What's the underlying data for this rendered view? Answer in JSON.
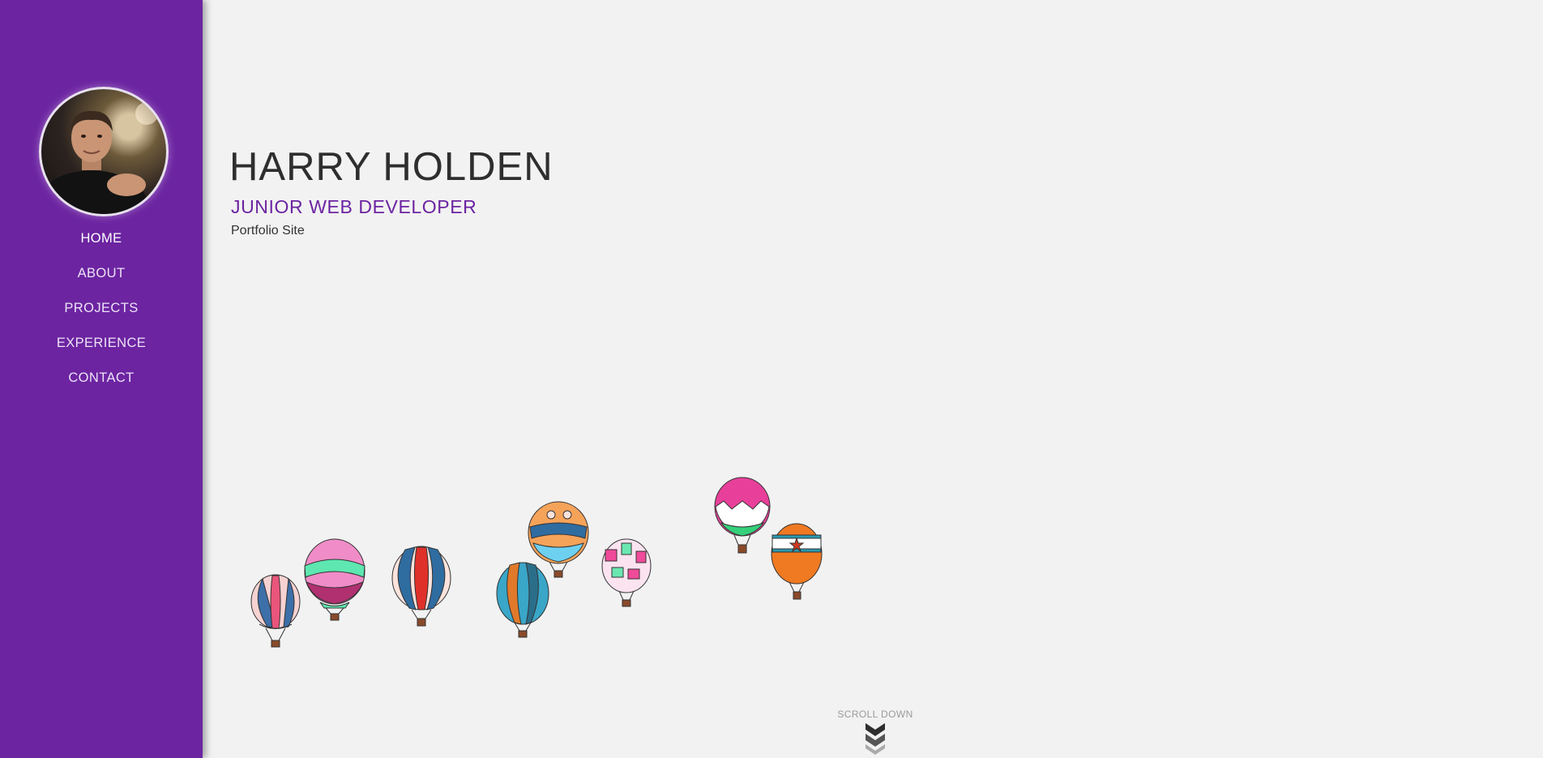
{
  "theme": {
    "accent": "#6c24a1",
    "background": "#f2f2f2",
    "text": "#2e2e2e"
  },
  "sidebar": {
    "avatar_icon": "profile-photo",
    "nav": [
      {
        "label": "HOME",
        "active": true
      },
      {
        "label": "ABOUT",
        "active": false
      },
      {
        "label": "PROJECTS",
        "active": false
      },
      {
        "label": "EXPERIENCE",
        "active": false
      },
      {
        "label": "CONTACT",
        "active": false
      }
    ]
  },
  "hero": {
    "name": "HARRY HOLDEN",
    "role": "JUNIOR WEB DEVELOPER",
    "tagline": "Portfolio Site",
    "decoration_icon": "hot-air-balloons"
  },
  "scroll": {
    "label": "SCROLL DOWN",
    "icon": "chevron-down-icon"
  }
}
